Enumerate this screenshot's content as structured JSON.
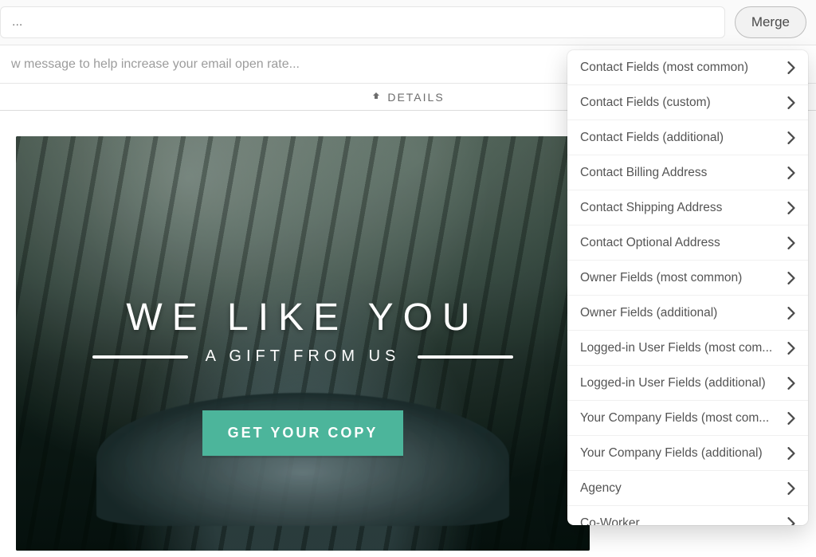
{
  "toolbar": {
    "subject_value": "...",
    "merge_label": "Merge"
  },
  "preview": {
    "placeholder": "w message to help increase your email open rate..."
  },
  "details": {
    "label": "DETAILS"
  },
  "hero": {
    "title": "WE LIKE YOU",
    "subtitle": "A GIFT FROM US",
    "cta": "GET YOUR COPY"
  },
  "merge_panel": {
    "items": [
      "Contact Fields (most common)",
      "Contact Fields (custom)",
      "Contact Fields (additional)",
      "Contact Billing Address",
      "Contact Shipping Address",
      "Contact Optional Address",
      "Owner Fields (most common)",
      "Owner Fields (additional)",
      "Logged-in User Fields (most com...",
      "Logged-in User Fields (additional)",
      "Your Company Fields (most com...",
      "Your Company Fields (additional)",
      "Agency",
      "Co-Worker"
    ]
  }
}
